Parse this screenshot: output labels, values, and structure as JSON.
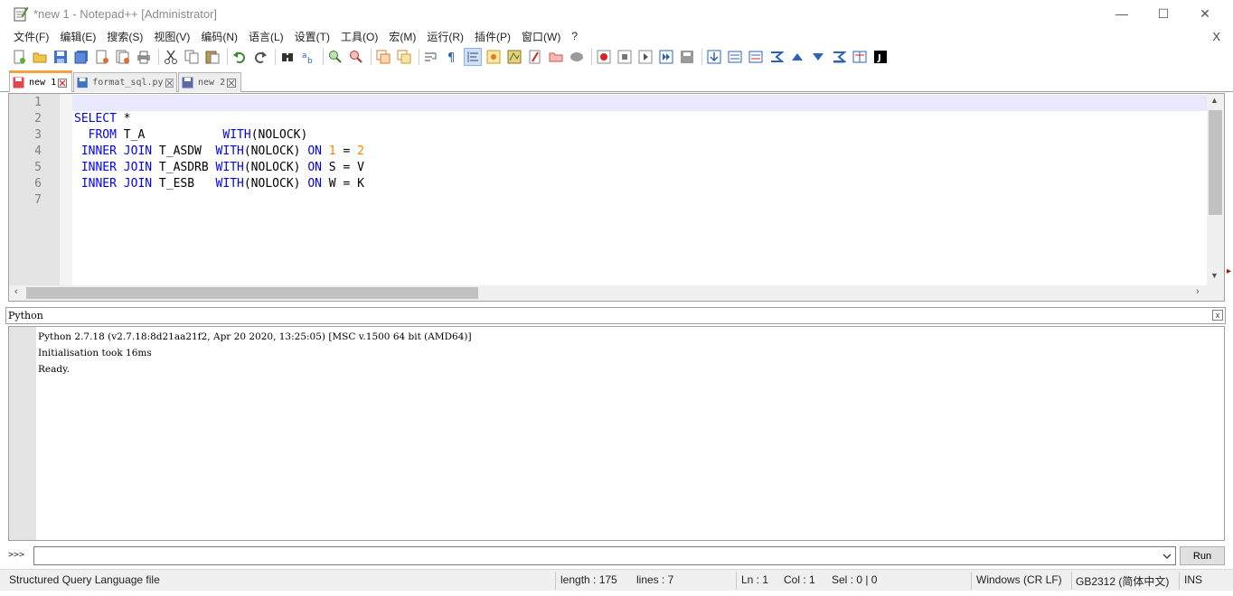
{
  "window": {
    "title": "*new 1 - Notepad++ [Administrator]",
    "minimize": "—",
    "maximize": "☐",
    "close": "✕"
  },
  "menu": {
    "items": [
      "文件(F)",
      "编辑(E)",
      "搜索(S)",
      "视图(V)",
      "编码(N)",
      "语言(L)",
      "设置(T)",
      "工具(O)",
      "宏(M)",
      "运行(R)",
      "插件(P)",
      "窗口(W)",
      "?"
    ],
    "close_doc": "X"
  },
  "toolbar": {
    "icons": [
      "new-file-icon",
      "open-file-icon",
      "save-icon",
      "save-all-icon",
      "close-icon",
      "close-all-icon",
      "print-icon",
      "cut-icon",
      "copy-icon",
      "paste-icon",
      "undo-icon",
      "redo-icon",
      "find-icon",
      "replace-icon",
      "zoom-in-icon",
      "zoom-out-icon",
      "sync-vertical-icon",
      "sync-horizontal-icon",
      "word-wrap-icon",
      "show-all-chars-icon",
      "indent-guide-icon",
      "udl-icon",
      "doc-map-icon",
      "function-list-icon",
      "folder-workspace-icon",
      "monitoring-icon",
      "record-macro-icon",
      "stop-macro-icon",
      "play-macro-icon",
      "run-macro-multiple-icon",
      "save-macro-icon",
      "plugin-1-icon",
      "plugin-2-icon",
      "plugin-3-icon",
      "plugin-4-icon",
      "plugin-5-icon",
      "plugin-6-icon",
      "plugin-7-icon",
      "plugin-8-icon",
      "plugin-9-icon"
    ]
  },
  "tabs": [
    {
      "label": "new 1",
      "active": true,
      "unsaved": true
    },
    {
      "label": "format_sql.py",
      "active": false,
      "unsaved": false
    },
    {
      "label": "new 2",
      "active": false,
      "unsaved": false
    }
  ],
  "editor": {
    "lines": [
      {
        "num": "1",
        "tokens": []
      },
      {
        "num": "2",
        "tokens": [
          {
            "t": "SELECT",
            "c": "kw"
          },
          {
            "t": " *",
            "c": "id"
          }
        ]
      },
      {
        "num": "3",
        "tokens": [
          {
            "t": "  FROM",
            "c": "kw"
          },
          {
            "t": " T_A           ",
            "c": "id"
          },
          {
            "t": "WITH",
            "c": "kw"
          },
          {
            "t": "(NOLOCK)",
            "c": "id"
          }
        ]
      },
      {
        "num": "4",
        "tokens": [
          {
            "t": " INNER JOIN",
            "c": "kw"
          },
          {
            "t": " T_ASDW  ",
            "c": "id"
          },
          {
            "t": "WITH",
            "c": "kw"
          },
          {
            "t": "(NOLOCK) ",
            "c": "id"
          },
          {
            "t": "ON",
            "c": "kw"
          },
          {
            "t": " ",
            "c": "id"
          },
          {
            "t": "1",
            "c": "num"
          },
          {
            "t": " = ",
            "c": "id"
          },
          {
            "t": "2",
            "c": "num"
          }
        ]
      },
      {
        "num": "5",
        "tokens": [
          {
            "t": " INNER JOIN",
            "c": "kw"
          },
          {
            "t": " T_ASDRB ",
            "c": "id"
          },
          {
            "t": "WITH",
            "c": "kw"
          },
          {
            "t": "(NOLOCK) ",
            "c": "id"
          },
          {
            "t": "ON",
            "c": "kw"
          },
          {
            "t": " S = V",
            "c": "id"
          }
        ]
      },
      {
        "num": "6",
        "tokens": [
          {
            "t": " INNER JOIN",
            "c": "kw"
          },
          {
            "t": " T_ESB   ",
            "c": "id"
          },
          {
            "t": "WITH",
            "c": "kw"
          },
          {
            "t": "(NOLOCK) ",
            "c": "id"
          },
          {
            "t": "ON",
            "c": "kw"
          },
          {
            "t": " W = K",
            "c": "id"
          }
        ]
      },
      {
        "num": "7",
        "tokens": []
      }
    ]
  },
  "console": {
    "title": "Python",
    "close": "x",
    "lines": [
      "Python 2.7.18 (v2.7.18:8d21aa21f2, Apr 20 2020, 13:25:05) [MSC v.1500 64 bit (AMD64)]",
      "Initialisation took 16ms",
      "Ready."
    ],
    "prompt": ">>>",
    "input_value": "",
    "run_label": "Run"
  },
  "status": {
    "file_type": "Structured Query Language file",
    "length": "length : 175",
    "lines": "lines : 7",
    "ln": "Ln : 1",
    "col": "Col : 1",
    "sel": "Sel : 0 | 0",
    "eol": "Windows (CR LF)",
    "encoding": "GB2312 (简体中文)",
    "mode": "INS"
  },
  "colors": {
    "keyword": "#0000ff",
    "number": "#ff8000",
    "current_line": "#e8e8ff",
    "active_tab_accent": "#f7a23a"
  }
}
